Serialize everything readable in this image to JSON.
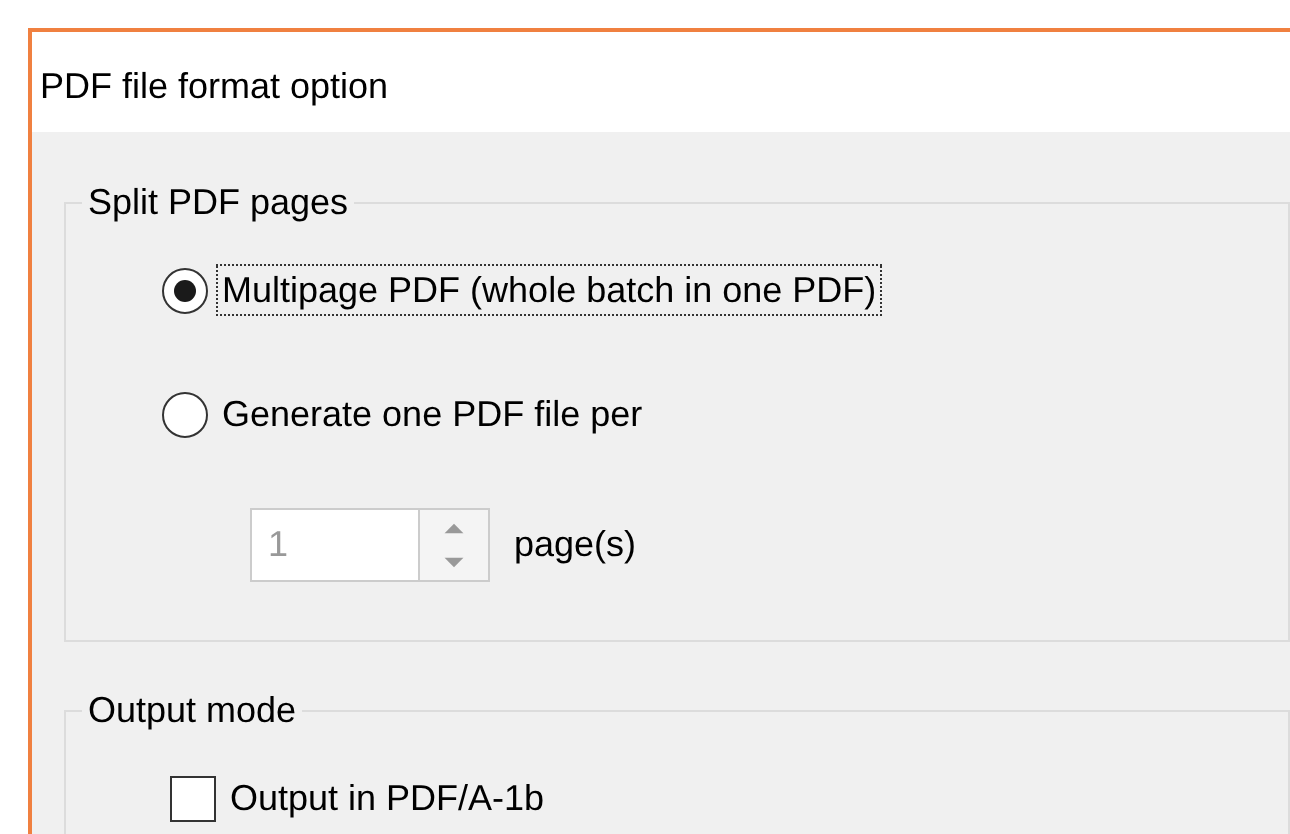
{
  "window": {
    "title": "PDF file format option"
  },
  "groups": [
    {
      "label": "Split PDF pages",
      "items": [
        {
          "kind": "radio",
          "label": "Multipage PDF (whole batch in one PDF)",
          "selected": true,
          "focused": true
        },
        {
          "kind": "radio",
          "label": "Generate one PDF file per",
          "selected": false
        },
        {
          "kind": "spinner",
          "value": "1",
          "unit": "page(s)",
          "disabled": true
        }
      ]
    },
    {
      "label": "Output mode",
      "items": [
        {
          "kind": "checkbox",
          "label": "Output in PDF/A-1b",
          "checked": false
        }
      ]
    }
  ]
}
